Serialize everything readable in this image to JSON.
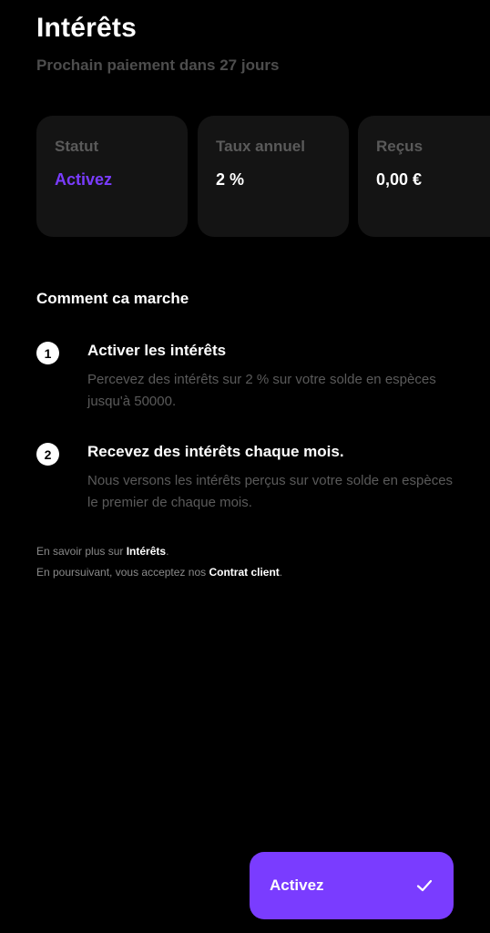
{
  "header": {
    "title": "Intérêts",
    "subtitle": "Prochain paiement dans 27 jours"
  },
  "stats": [
    {
      "label": "Statut",
      "value": "Activez"
    },
    {
      "label": "Taux annuel",
      "value": "2 %"
    },
    {
      "label": "Reçus",
      "value": "0,00 €"
    }
  ],
  "how_it_works": {
    "title": "Comment ca marche",
    "steps": [
      {
        "number": "1",
        "title": "Activer les intérêts",
        "description": "Percevez des intérêts sur 2 % sur votre solde en espèces jusqu'à 50000."
      },
      {
        "number": "2",
        "title": "Recevez des intérêts chaque mois.",
        "description": "Nous versons les intérêts perçus sur votre solde en espèces le premier de chaque mois."
      }
    ]
  },
  "footer": {
    "learn_more_prefix": "En savoir plus sur ",
    "learn_more_link": "Intérêts",
    "learn_more_suffix": ".",
    "terms_prefix": "En poursuivant, vous acceptez nos ",
    "terms_link": "Contrat client",
    "terms_suffix": "."
  },
  "cta": {
    "label": "Activez",
    "icon": "check-icon"
  },
  "colors": {
    "background": "#000000",
    "card": "#141414",
    "accent": "#7a3cff",
    "muted": "#5a5a5a"
  }
}
